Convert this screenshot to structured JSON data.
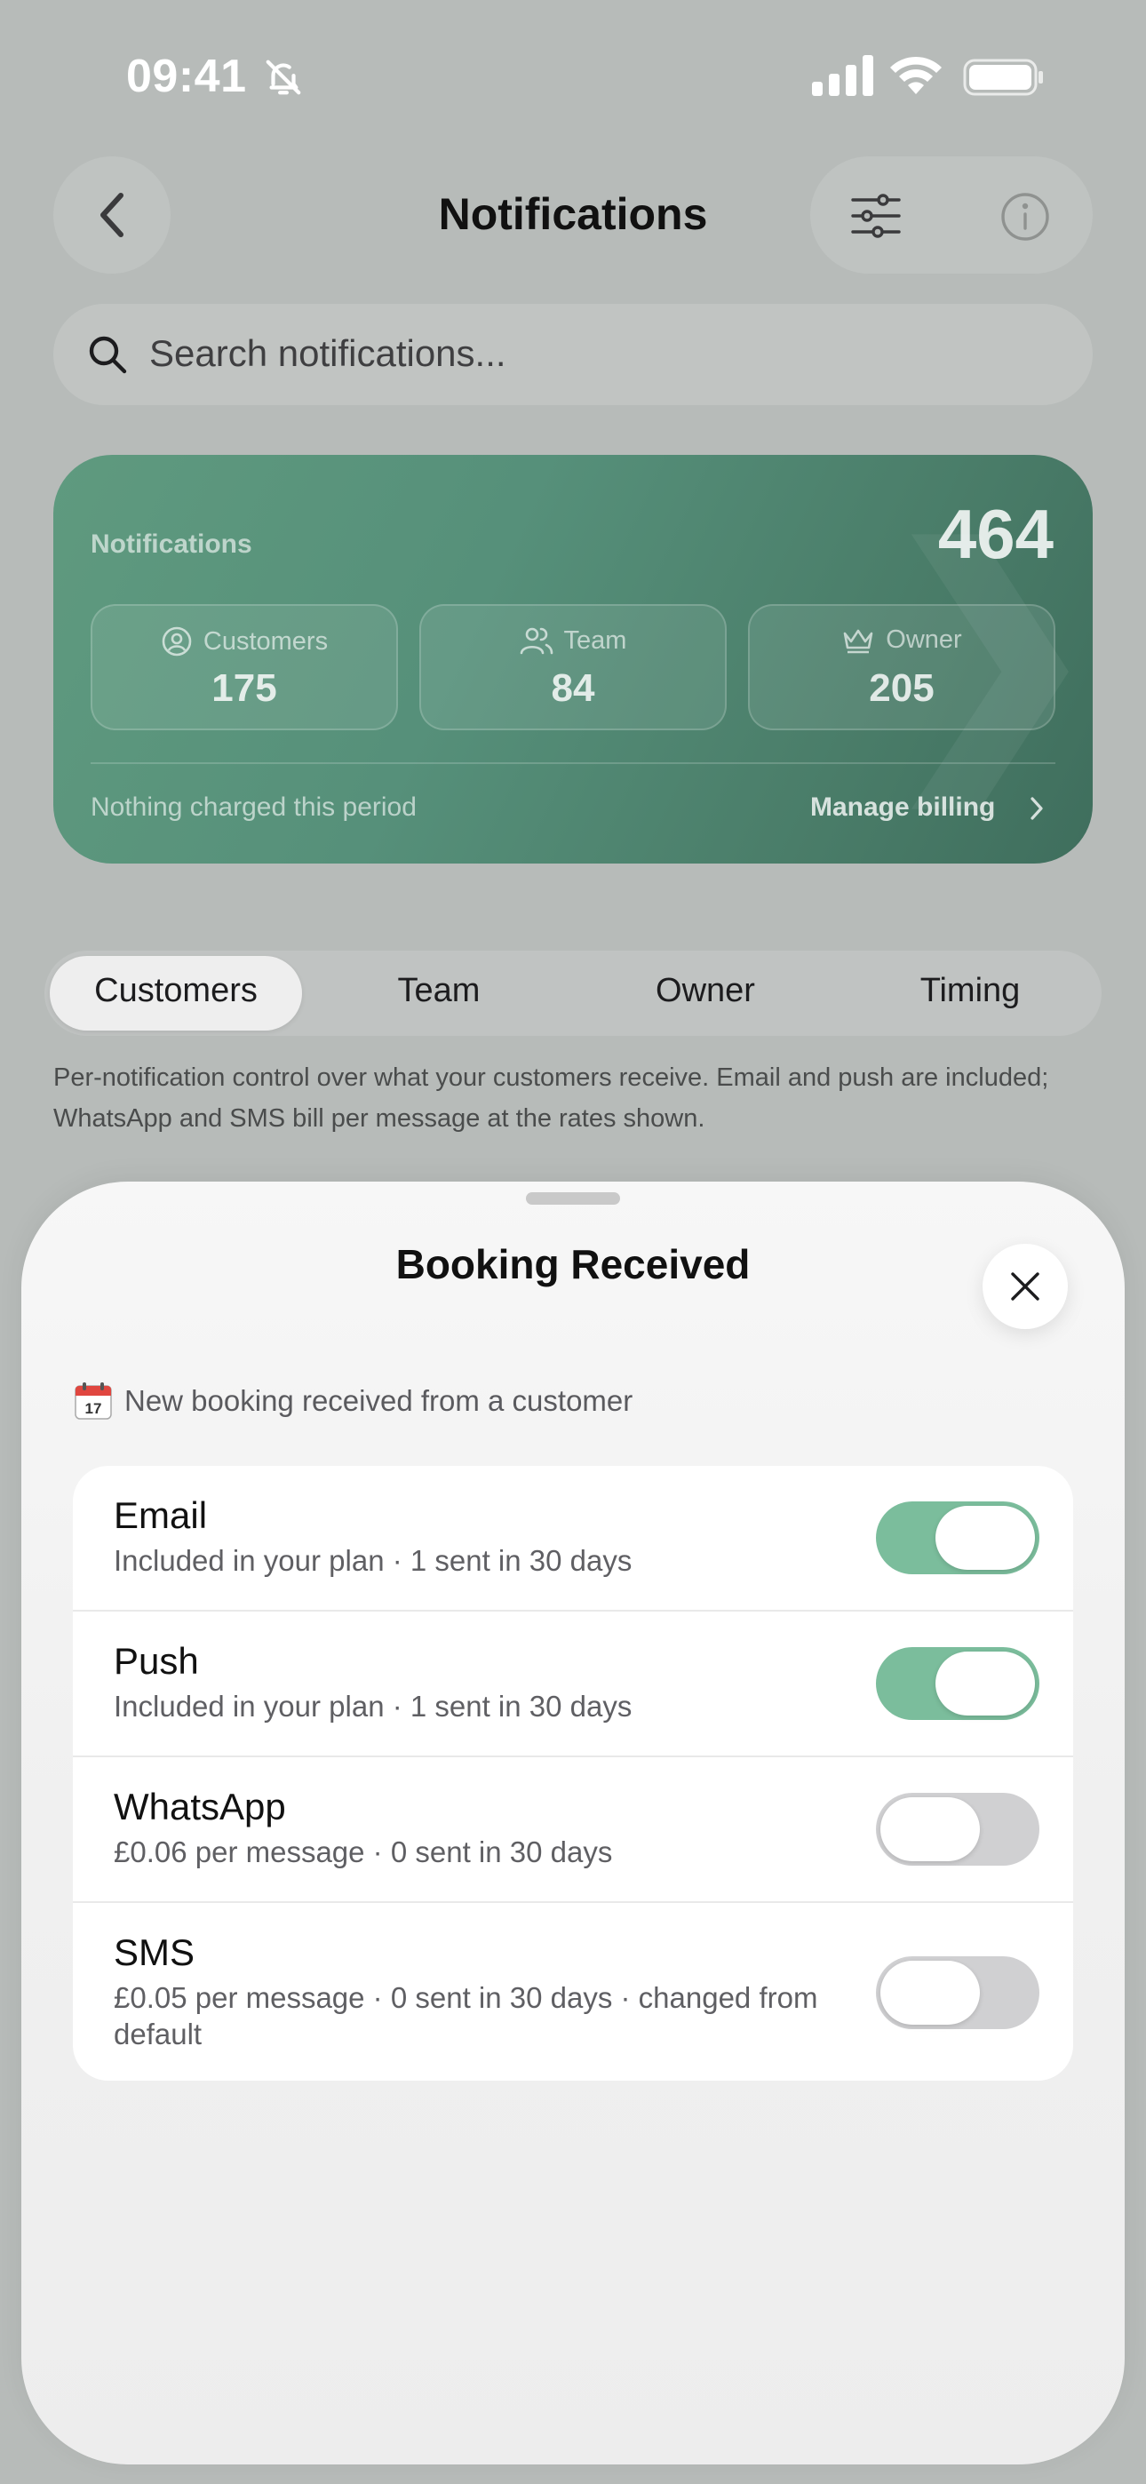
{
  "status_bar": {
    "time": "09:41"
  },
  "header": {
    "title": "Notifications"
  },
  "search": {
    "placeholder": "Search notifications..."
  },
  "summary_card": {
    "label": "Notifications",
    "total": "464",
    "stats": [
      {
        "label": "Customers",
        "value": "175",
        "icon": "user-circle-icon"
      },
      {
        "label": "Team",
        "value": "84",
        "icon": "users-icon"
      },
      {
        "label": "Owner",
        "value": "205",
        "icon": "crown-icon"
      }
    ],
    "footer_text": "Nothing charged this period",
    "billing_link": "Manage billing"
  },
  "tabs": [
    {
      "label": "Customers",
      "active": true
    },
    {
      "label": "Team",
      "active": false
    },
    {
      "label": "Owner",
      "active": false
    },
    {
      "label": "Timing",
      "active": false
    }
  ],
  "description": "Per-notification control over what your customers receive. Email and push are included; WhatsApp and SMS bill per message at the rates shown.",
  "sheet": {
    "title": "Booking Received",
    "subtitle": "New booking received from a customer",
    "channels": [
      {
        "title": "Email",
        "subtitle": "Included in your plan · 1 sent in 30 days",
        "enabled": true
      },
      {
        "title": "Push",
        "subtitle": "Included in your plan · 1 sent in 30 days",
        "enabled": true
      },
      {
        "title": "WhatsApp",
        "subtitle": "£0.06 per message · 0 sent in 30 days",
        "enabled": false
      },
      {
        "title": "SMS",
        "subtitle": "£0.05 per message · 0 sent in 30 days · changed from default",
        "enabled": false
      }
    ]
  },
  "colors": {
    "accent_green": "#7bbd9c",
    "card_green": "#56907a",
    "backdrop": "#b7bbb9"
  }
}
